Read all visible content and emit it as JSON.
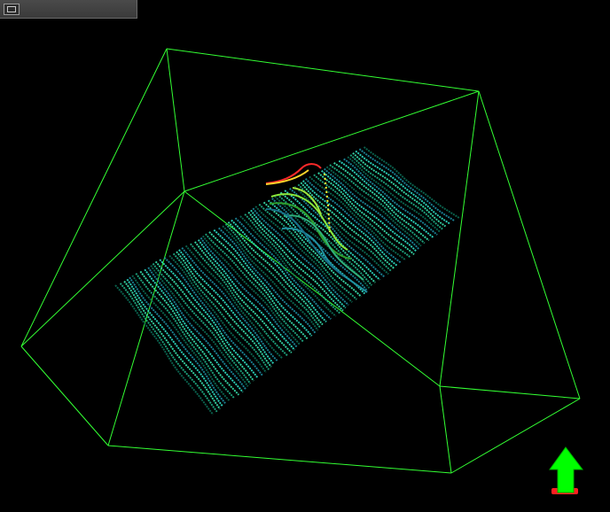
{
  "viewer": {
    "background_color": "#000000",
    "bounding_box_color": "#33ff33",
    "surface_palette": [
      "#0b6b55",
      "#1fae86",
      "#39e3b0",
      "#2ee0c8",
      "#1c8ca0",
      "#0e4f74"
    ],
    "highlight_palette": [
      "#ff2a2a",
      "#ffd52a",
      "#ffff33",
      "#8be83a",
      "#2d9f2d"
    ]
  },
  "toolbar": {
    "window_button_icon": "window-restore-icon"
  },
  "orientation_indicator": {
    "icon": "up-arrow-icon",
    "arrow_color": "#00ff00",
    "base_color": "#ff2020"
  }
}
